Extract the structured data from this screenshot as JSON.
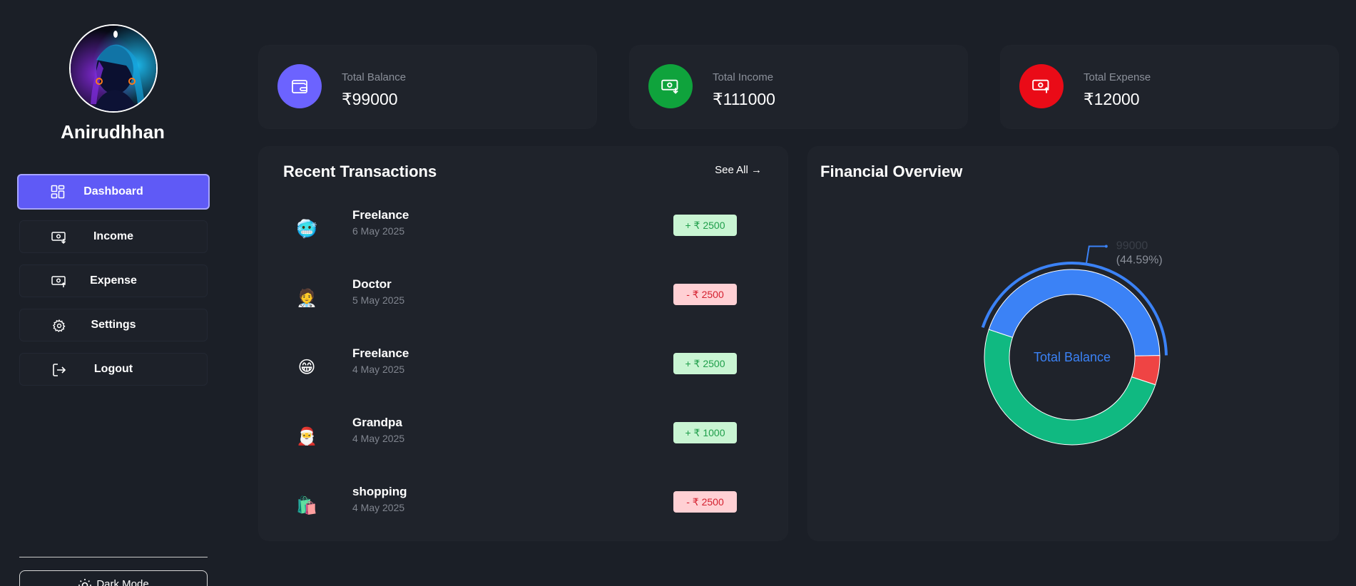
{
  "user": {
    "name": "Anirudhhan"
  },
  "nav": [
    {
      "label": "Dashboard",
      "icon": "dashboard-icon",
      "active": true
    },
    {
      "label": "Income",
      "icon": "income-icon",
      "active": false
    },
    {
      "label": "Expense",
      "icon": "expense-icon",
      "active": false
    },
    {
      "label": "Settings",
      "icon": "gear-icon",
      "active": false
    },
    {
      "label": "Logout",
      "icon": "logout-icon",
      "active": false
    }
  ],
  "dark_mode_label": "Dark Mode",
  "stats": [
    {
      "label": "Total Balance",
      "value": "₹99000",
      "color": "#6c63ff",
      "icon": "wallet-icon"
    },
    {
      "label": "Total Income",
      "value": "₹111000",
      "color": "#0fa33c",
      "icon": "money-in-icon"
    },
    {
      "label": "Total Expense",
      "value": "₹12000",
      "color": "#ea0b17",
      "icon": "money-out-icon"
    }
  ],
  "recent": {
    "title": "Recent Transactions",
    "see_all": "See All →",
    "items": [
      {
        "title": "Freelance",
        "date": "6 May 2025",
        "amount": "+ ₹ 2500",
        "type": "income",
        "emoji": "🥶"
      },
      {
        "title": "Doctor",
        "date": "5 May 2025",
        "amount": "- ₹ 2500",
        "type": "expense",
        "emoji": "🧑‍⚕️"
      },
      {
        "title": "Freelance",
        "date": "4 May 2025",
        "amount": "+ ₹ 2500",
        "type": "income",
        "emoji": "😁"
      },
      {
        "title": "Grandpa",
        "date": "4 May 2025",
        "amount": "+ ₹ 1000",
        "type": "income",
        "emoji": "🎅"
      },
      {
        "title": "shopping",
        "date": "4 May 2025",
        "amount": "- ₹ 2500",
        "type": "expense",
        "emoji": "🛍️"
      }
    ]
  },
  "overview": {
    "title": "Financial Overview",
    "center_label": "Total Balance",
    "tooltip_value": "99000",
    "tooltip_percent": "(44.59%)"
  },
  "chart_data": {
    "type": "pie",
    "categories": [
      "Total Balance",
      "Total Expense",
      "Total Income"
    ],
    "values": [
      99000,
      12000,
      111000
    ],
    "colors": [
      "#3b82f6",
      "#ef4444",
      "#10b981"
    ],
    "donut": true,
    "highlighted": "Total Balance"
  }
}
